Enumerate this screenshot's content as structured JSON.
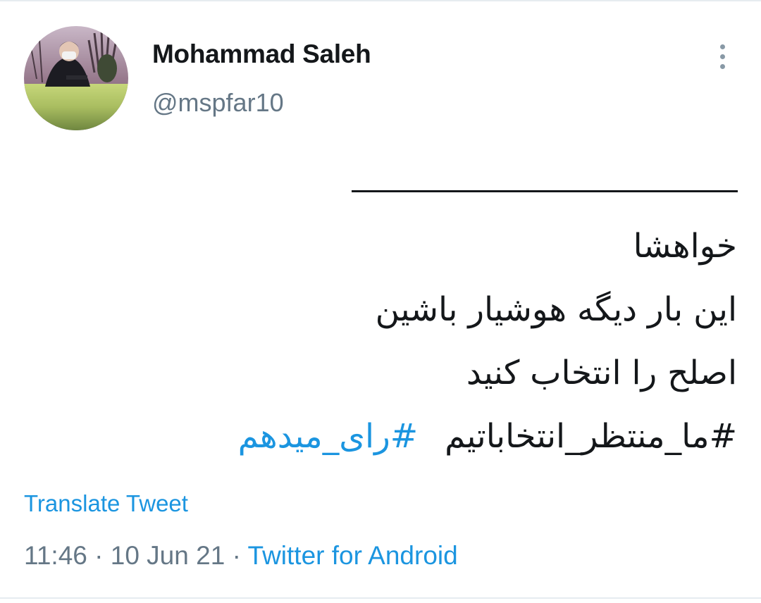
{
  "author": {
    "display_name": "Mohammad Saleh",
    "handle": "@mspfar10",
    "avatar_icon": "profile-photo"
  },
  "menu": {
    "icon": "more-vertical-icon"
  },
  "tweet": {
    "lines": [
      "خواهشا",
      "این بار دیگه هوشیار باشین",
      "اصلح را انتخاب کنید"
    ],
    "hashtags": [
      "#ما_منتظر_انتخاباتیم",
      "#رای_میدهم"
    ]
  },
  "translate_label": "Translate Tweet",
  "meta": {
    "time": "11:46",
    "separator": "·",
    "date": "10 Jun 21",
    "source": "Twitter for Android"
  },
  "colors": {
    "link": "#1b95e0",
    "secondary_text": "#657786",
    "primary_text": "#14171a"
  }
}
